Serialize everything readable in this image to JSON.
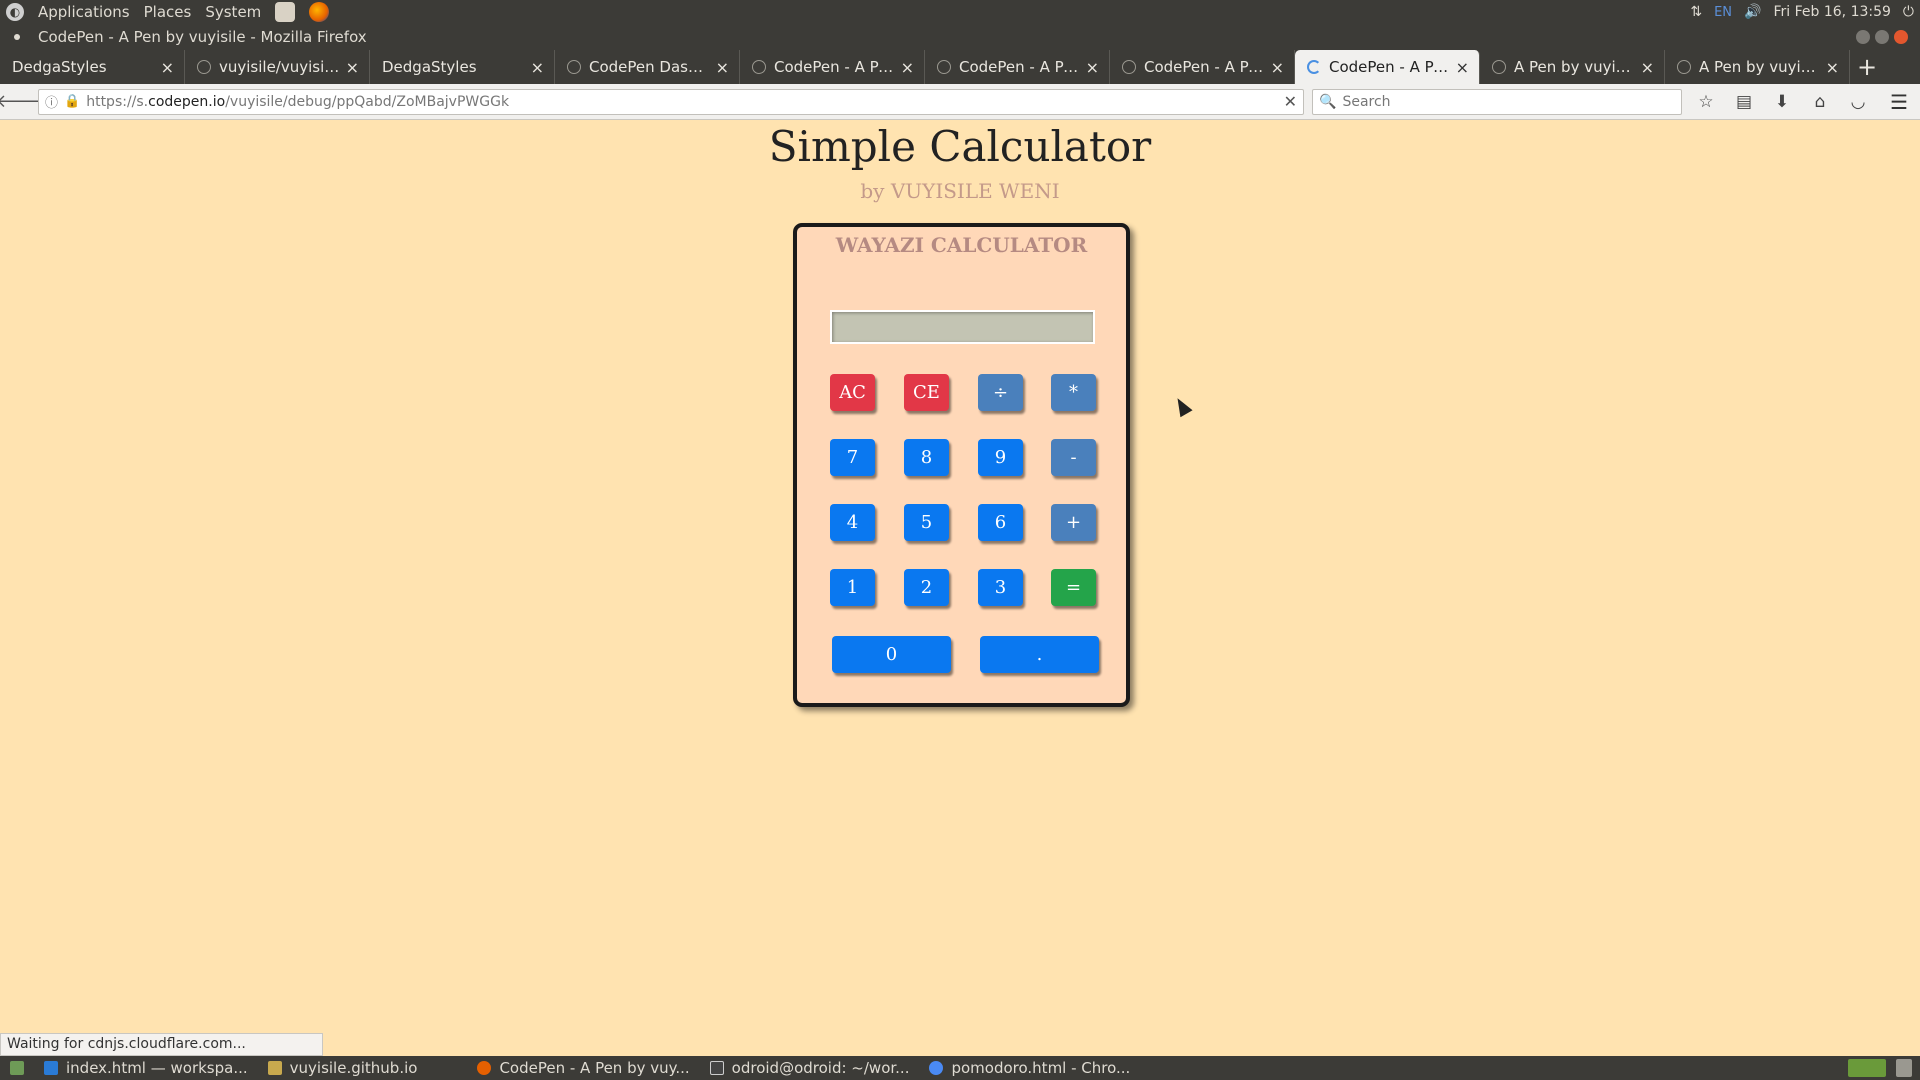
{
  "panel": {
    "menus": [
      "Applications",
      "Places",
      "System"
    ],
    "lang": "EN",
    "clock": "Fri Feb 16, 13:59"
  },
  "window": {
    "title": "CodePen - A Pen by vuyisile - Mozilla Firefox"
  },
  "tabs": [
    {
      "label": "DedgaStyles",
      "favicon": "none"
    },
    {
      "label": "vuyisile/vuyisile....",
      "favicon": "github-icon"
    },
    {
      "label": "DedgaStyles",
      "favicon": "none"
    },
    {
      "label": "CodePen Dashb...",
      "favicon": "codepen-icon"
    },
    {
      "label": "CodePen - A Pen...",
      "favicon": "codepen-icon"
    },
    {
      "label": "CodePen - A Pen...",
      "favicon": "codepen-icon"
    },
    {
      "label": "CodePen - A Pen...",
      "favicon": "codepen-icon"
    },
    {
      "label": "CodePen - A Pen...",
      "favicon": "loading-icon",
      "active": true
    },
    {
      "label": "A Pen by vuyisile",
      "favicon": "codepen-icon"
    },
    {
      "label": "A Pen by vuyisile",
      "favicon": "codepen-icon"
    }
  ],
  "navbar": {
    "url_prefix": "https://s.",
    "url_domain": "codepen.io",
    "url_path": "/vuyisile/debug/ppQabd/ZoMBajvPWGGk",
    "search_placeholder": "Search"
  },
  "page": {
    "title": "Simple Calculator",
    "subtitle": "by VUYISILE WENI",
    "calculator": {
      "title": "WAYAZI CALCULATOR",
      "display_value": "",
      "buttons": {
        "ac": "AC",
        "ce": "CE",
        "divide": "÷",
        "multiply": "*",
        "seven": "7",
        "eight": "8",
        "nine": "9",
        "minus": "-",
        "four": "4",
        "five": "5",
        "six": "6",
        "plus": "+",
        "one": "1",
        "two": "2",
        "three": "3",
        "equals": "=",
        "zero": "0",
        "dot": "."
      }
    }
  },
  "status": "Waiting for cdnjs.cloudflare.com...",
  "taskbar": [
    {
      "label": "index.html — workspa...",
      "icon": "editor-icon"
    },
    {
      "label": "vuyisile.github.io",
      "icon": "folder-icon"
    },
    {
      "label": "CodePen - A Pen by vuy...",
      "icon": "firefox-icon"
    },
    {
      "label": "odroid@odroid: ~/wor...",
      "icon": "terminal-icon"
    },
    {
      "label": "pomodoro.html - Chro...",
      "icon": "chrome-icon"
    }
  ],
  "colors": {
    "page_bg": "#ffe3b0",
    "calc_bg": "#ffd8b8",
    "num_btn": "#0a78f0",
    "op_btn": "#4a80bc",
    "clear_btn": "#e23747",
    "equals_btn": "#24a44a"
  }
}
